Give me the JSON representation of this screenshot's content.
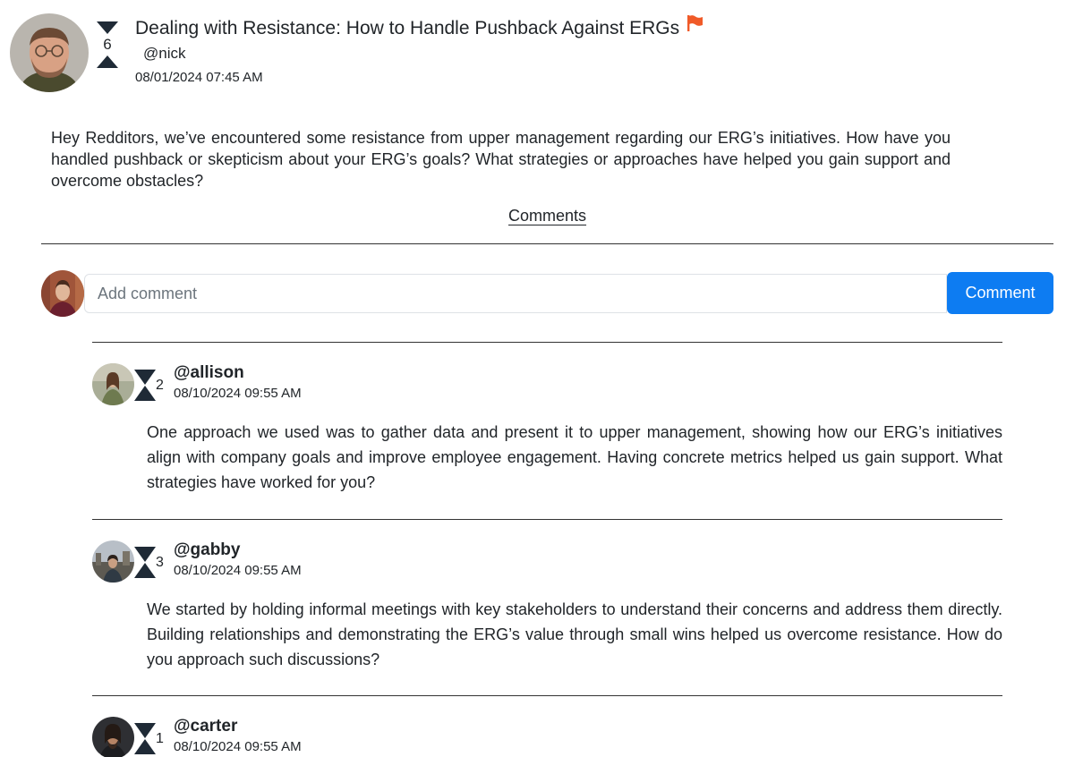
{
  "post": {
    "title": "Dealing with Resistance: How to Handle Pushback Against ERGs",
    "score": "6",
    "author": "@nick",
    "date": "08/01/2024 07:45 AM",
    "body": "Hey Redditors, we’ve encountered some resistance from upper management regarding our ERG’s initiatives. How have you handled pushback or skepticism about your ERG’s goals? What strategies or approaches have helped you gain support and overcome obstacles?",
    "comments_link": "Comments",
    "flag_color": "#f05a28"
  },
  "composer": {
    "placeholder": "Add comment",
    "button_label": "Comment",
    "button_color": "#0d7cf2"
  },
  "comments": [
    {
      "author": "@allison",
      "score": "2",
      "date": "08/10/2024 09:55 AM",
      "body": "One approach we used was to gather data and present it to upper management, showing how our ERG’s initiatives align with company goals and improve employee engagement. Having concrete metrics helped us gain support. What strategies have worked for you?"
    },
    {
      "author": "@gabby",
      "score": "3",
      "date": "08/10/2024 09:55 AM",
      "body": "We started by holding informal meetings with key stakeholders to understand their concerns and address them directly. Building relationships and demonstrating the ERG’s value through small wins helped us overcome resistance. How do you approach such discussions?"
    },
    {
      "author": "@carter",
      "score": "1",
      "date": "08/10/2024 09:55 AM",
      "body": ""
    }
  ]
}
